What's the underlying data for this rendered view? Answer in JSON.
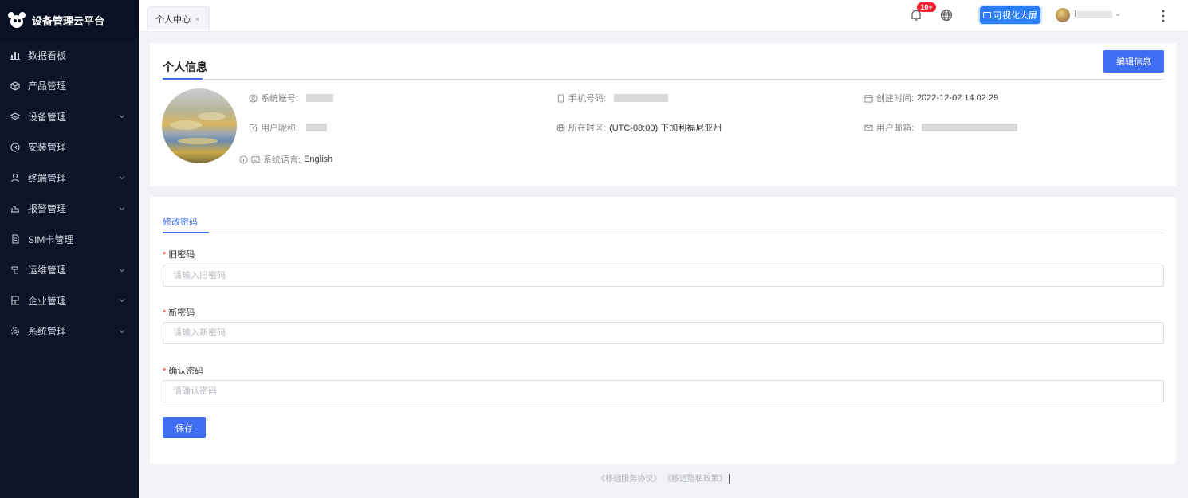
{
  "app": {
    "title": "设备管理云平台"
  },
  "sidebar": {
    "items": [
      {
        "label": "数据看板",
        "icon": "chart-bars-icon",
        "expandable": false
      },
      {
        "label": "产品管理",
        "icon": "cube-icon",
        "expandable": false
      },
      {
        "label": "设备管理",
        "icon": "layers-icon",
        "expandable": true
      },
      {
        "label": "安装管理",
        "icon": "wrench-icon",
        "expandable": false
      },
      {
        "label": "终端管理",
        "icon": "user-icon",
        "expandable": true
      },
      {
        "label": "报警管理",
        "icon": "alarm-icon",
        "expandable": true
      },
      {
        "label": "SIM卡管理",
        "icon": "sim-card-icon",
        "expandable": false
      },
      {
        "label": "运维管理",
        "icon": "maintenance-icon",
        "expandable": true
      },
      {
        "label": "企业管理",
        "icon": "building-icon",
        "expandable": true
      },
      {
        "label": "系统管理",
        "icon": "gear-icon",
        "expandable": true
      }
    ]
  },
  "header": {
    "tab_label": "个人中心",
    "tab_close": "×",
    "notification_badge": "10+",
    "visual_screen_label": "可视化大屏"
  },
  "profile": {
    "section_title": "个人信息",
    "edit_label": "编辑信息",
    "account_label": "系统账号:",
    "nickname_label": "用户昵称:",
    "language_label": "系统语言:",
    "language_value": "English",
    "phone_label": "手机号码:",
    "timezone_label": "所在时区:",
    "timezone_value": "(UTC-08:00) 下加利福尼亚州",
    "created_label": "创建时间:",
    "created_value": "2022-12-02 14:02:29",
    "email_label": "用户邮箱:"
  },
  "password": {
    "tab_label": "修改密码",
    "required_mark": "*",
    "old_label": "旧密码",
    "old_placeholder": "请输入旧密码",
    "new_label": "新密码",
    "new_placeholder": "请输入新密码",
    "confirm_label": "确认密码",
    "confirm_placeholder": "请确认密码",
    "save_label": "保存"
  },
  "footer": {
    "service_link": "《移远服务协议》",
    "privacy_link": "《移远隐私政策》"
  },
  "colors": {
    "sidebar_bg": "#0c1427",
    "primary": "#3f6ef2",
    "visual_btn": "#2a7df5",
    "badge": "#f5222d",
    "page_bg": "#f0f2f5"
  }
}
